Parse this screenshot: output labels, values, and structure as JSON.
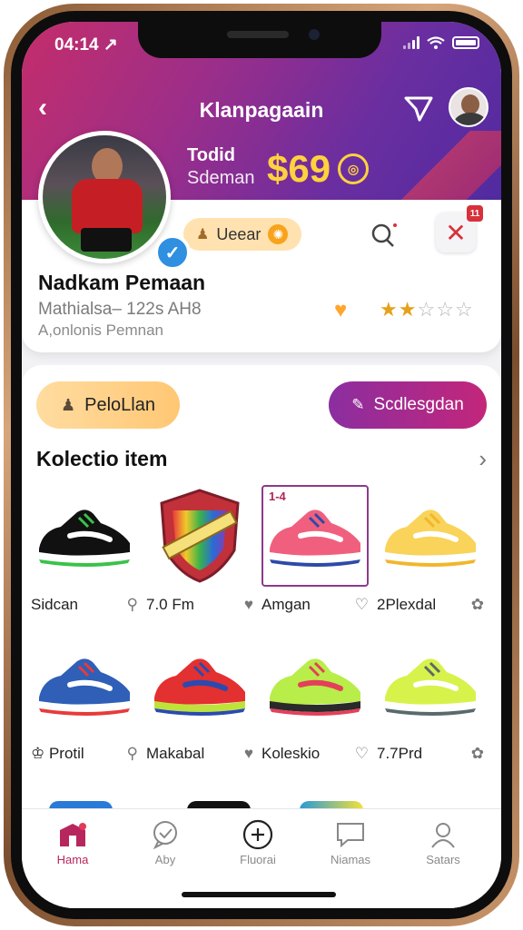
{
  "status": {
    "time": "04:14 ↗"
  },
  "header": {
    "title": "Klanpagaain"
  },
  "stats": {
    "line1": "Todid",
    "line2": "Sdeman",
    "price": "$69"
  },
  "profile": {
    "user_pill": "Ueear",
    "close_badge": "11",
    "name": "Nadkam Pemaan",
    "subtitle": "Mathialsa– 122s AH8",
    "subtitle2": "A,onlonis Pemnan",
    "rating": 2,
    "rating_max": 5
  },
  "actions": {
    "primary": "PeloLlan",
    "secondary": "Scdlesgdan"
  },
  "collection": {
    "title": "Kolectio item",
    "items": [
      {
        "label": "Sidcan",
        "icon": "pin-icon",
        "kind": "shoe",
        "colors": [
          "#111",
          "#3ac24a",
          "#fff"
        ]
      },
      {
        "label": "7.0 Fm",
        "icon": "heart-icon",
        "kind": "badge",
        "colors": []
      },
      {
        "label": "Amgan",
        "icon": "heart-outline-icon",
        "kind": "shoe",
        "colors": [
          "#f0607e",
          "#2d4aa8",
          "#fff"
        ],
        "selected": true,
        "badge": "1-4"
      },
      {
        "label": "2Plexdal",
        "icon": "flower-icon",
        "kind": "shoe",
        "colors": [
          "#f9d35a",
          "#f1b62c",
          "#fff"
        ]
      },
      {
        "label": "Protil",
        "icon": "pin-icon",
        "kind": "shoe",
        "colors": [
          "#2f5fb7",
          "#e83a3a",
          "#fff"
        ],
        "prefix_icon": true
      },
      {
        "label": "Makabal",
        "icon": "heart-icon",
        "kind": "shoe",
        "colors": [
          "#e33030",
          "#2a4ab0",
          "#bfe23a"
        ]
      },
      {
        "label": "Koleskio",
        "icon": "heart-outline-icon",
        "kind": "shoe",
        "colors": [
          "#b9ed4a",
          "#e4405a",
          "#2a2a2a"
        ]
      },
      {
        "label": "7.7Prd",
        "icon": "flower-icon",
        "kind": "shoe",
        "colors": [
          "#d7f24a",
          "#5a6a6a",
          "#fff"
        ]
      }
    ]
  },
  "nav": [
    {
      "label": "Hama",
      "icon": "shop-icon",
      "active": true
    },
    {
      "label": "Aby",
      "icon": "chat-check-icon"
    },
    {
      "label": "Fluorai",
      "icon": "plus-circle-icon"
    },
    {
      "label": "Niamas",
      "icon": "message-icon"
    },
    {
      "label": "Satars",
      "icon": "user-icon"
    }
  ],
  "colors": {
    "brand_start": "#c42d6a",
    "brand_end": "#4a2aa0",
    "accent_gold": "#ffd23e",
    "active_nav": "#b8265e"
  }
}
